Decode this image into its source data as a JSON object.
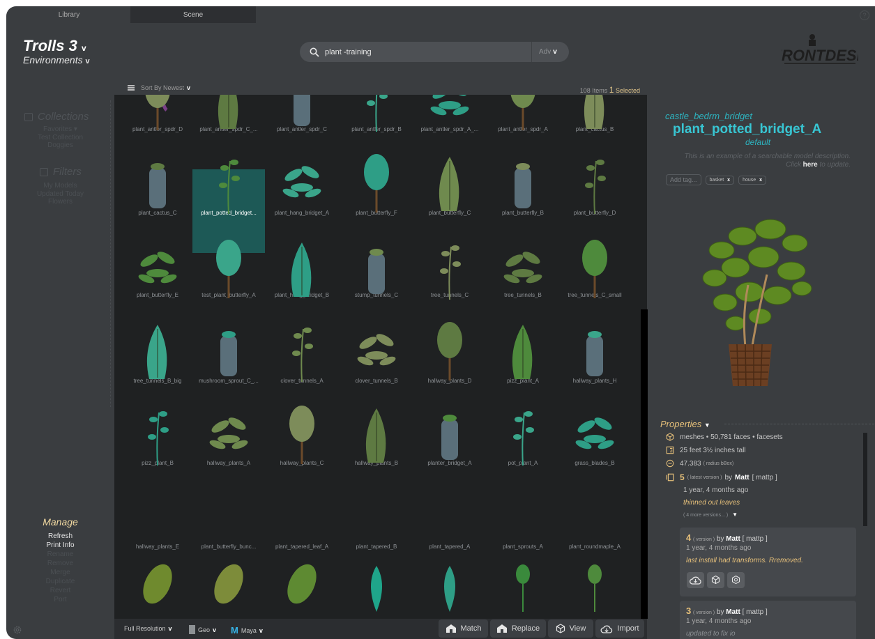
{
  "tabs": {
    "library": "Library",
    "scene": "Scene"
  },
  "header": {
    "project": "Trolls 3",
    "project_chevron": "v",
    "category": "Environments",
    "category_chevron": "v",
    "search_value": "plant -training",
    "adv_label": "Adv",
    "adv_chevron": "v",
    "help": "?",
    "logo_text": "FRONTDESK"
  },
  "sidebar": {
    "collections_title": "Collections",
    "collections": [
      "Favorites ▾",
      "Test Collection",
      "Doggies"
    ],
    "filters_title": "Filters",
    "filters": [
      "My Models",
      "Updated Today",
      "Flowers"
    ],
    "manage_title": "Manage",
    "manage_active": [
      "Refresh",
      "Print Info"
    ],
    "manage_inactive": [
      "Rename",
      "Remove",
      "Merge",
      "Duplicate",
      "Revert",
      "Port"
    ]
  },
  "toolbar": {
    "sort_label": "Sort By Newest",
    "sort_chevron": "v",
    "items_count": "108",
    "items_label": "Items",
    "selected_count": "1",
    "selected_label": "Selected"
  },
  "grid": {
    "rows": [
      [
        "plant_antler_spdr_D",
        "plant_antler_spdr_C_...",
        "plant_antler_spdr_C",
        "plant_antler_spdr_B",
        "plant_antler_spdr_A_...",
        "plant_antler_spdr_A",
        "plant_cactus_B"
      ],
      [
        "plant_cactus_C",
        "plant_potted_bridget...",
        "plant_hang_bridget_A",
        "plant_butterfly_F",
        "plant_butterfly_C",
        "plant_butterfly_B",
        "plant_butterfly_D"
      ],
      [
        "plant_butterfly_E",
        "test_plant_butterfly_A",
        "plant_hang_bridget_B",
        "stump_tunnels_C",
        "tree_tunnels_C",
        "tree_tunnels_B",
        "tree_tunnels_C_small"
      ],
      [
        "tree_tunnels_B_big",
        "mushroom_sprout_C_...",
        "clover_tunnels_A",
        "clover_tunnels_B",
        "hallway_plants_D",
        "pizz_plant_A",
        "hallway_plants_H"
      ],
      [
        "pizz_plant_B",
        "hallway_plants_A",
        "hallway_plants_C",
        "hallway_plants_B",
        "planter_bridget_A",
        "pot_plant_A",
        "grass_blades_B"
      ],
      [
        "hallway_plants_E",
        "plant_butterfly_bunc...",
        "plant_tapered_leaf_A",
        "plant_tapered_B",
        "plant_tapered_A",
        "plant_sprouts_A",
        "plant_roundmaple_A"
      ]
    ]
  },
  "bottombar": {
    "resolution": "Full Resolution",
    "geo": "Geo",
    "app_letter": "M",
    "app": "Maya",
    "chevron": "v",
    "match": "Match",
    "replace": "Replace",
    "view": "View",
    "import": "Import"
  },
  "detail": {
    "breadcrumb": "castle_bedrm_bridget",
    "title": "plant_potted_bridget_A",
    "variant": "default",
    "description": "This is an example of a searchable model description.",
    "update_prefix": "Click",
    "update_link": "here",
    "update_suffix": "to update.",
    "add_tag_placeholder": "Add tag...",
    "tags": [
      "basket",
      "house"
    ],
    "tag_remove": "x",
    "properties_title": "Properties",
    "meshes": "meshes • 50,781 faces •  facesets",
    "height": "25 feet 3½ inches tall",
    "radius_value": "47.383",
    "radius_label": "( radius bBox)",
    "version_num": "5",
    "version_note": "( latest version )",
    "by": "by",
    "author": "Matt",
    "author_handle": "[ mattp ]",
    "version_time": "1 year, 4 months ago",
    "version_comment": "thinned out leaves",
    "more_versions": "( 4 more versions... )",
    "versions": [
      {
        "num": "4",
        "note": "( version )",
        "author": "Matt",
        "handle": "[ mattp ]",
        "time": "1 year, 4 months ago",
        "comment": "last install had transforms.  Rremoved."
      },
      {
        "num": "3",
        "note": "( version )",
        "author": "Matt",
        "handle": "[ mattp ]",
        "time": "1 year, 4 months ago",
        "comment": "updated to fix io"
      }
    ]
  }
}
